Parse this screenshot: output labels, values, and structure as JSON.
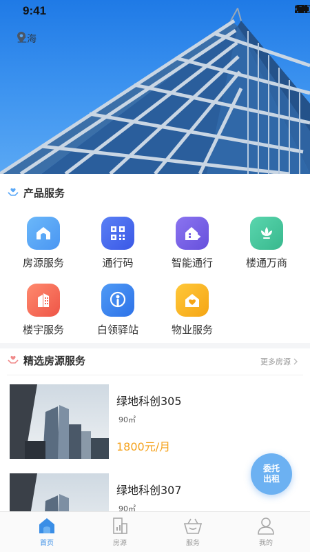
{
  "status_bar": {
    "time": "9:41"
  },
  "location": {
    "city": "上海"
  },
  "product_section": {
    "title": "产品服务"
  },
  "services": [
    {
      "label": "房源服务",
      "icon": "house-icon",
      "color": "#5aa8f7"
    },
    {
      "label": "通行码",
      "icon": "qr-code-icon",
      "color": "#4b6ef0"
    },
    {
      "label": "智能通行",
      "icon": "smart-home-icon",
      "color": "#7a63e8"
    },
    {
      "label": "楼通万商",
      "icon": "lotus-icon",
      "color": "#4cc8a0"
    },
    {
      "label": "楼宇服务",
      "icon": "building-icon",
      "color": "#f56b5a"
    },
    {
      "label": "白领驿站",
      "icon": "person-pin-icon",
      "color": "#3a86f0"
    },
    {
      "label": "物业服务",
      "icon": "heart-house-icon",
      "color": "#f8b62a"
    }
  ],
  "featured_section": {
    "title": "精选房源服务",
    "more": "更多房源"
  },
  "listings": [
    {
      "title": "绿地科创305",
      "area": "90㎡",
      "price": "1800元/月"
    },
    {
      "title": "绿地科创307",
      "area": "90㎡"
    }
  ],
  "fab": {
    "line1": "委托",
    "line2": "出租"
  },
  "tabs": [
    {
      "label": "首页",
      "icon": "home-icon",
      "active": true
    },
    {
      "label": "房源",
      "icon": "building-outline-icon"
    },
    {
      "label": "服务",
      "icon": "basket-icon"
    },
    {
      "label": "我的",
      "icon": "user-icon"
    }
  ],
  "colors": {
    "accent": "#3a8ee6",
    "price": "#f5a21c",
    "fab": "#6cb1f2"
  }
}
